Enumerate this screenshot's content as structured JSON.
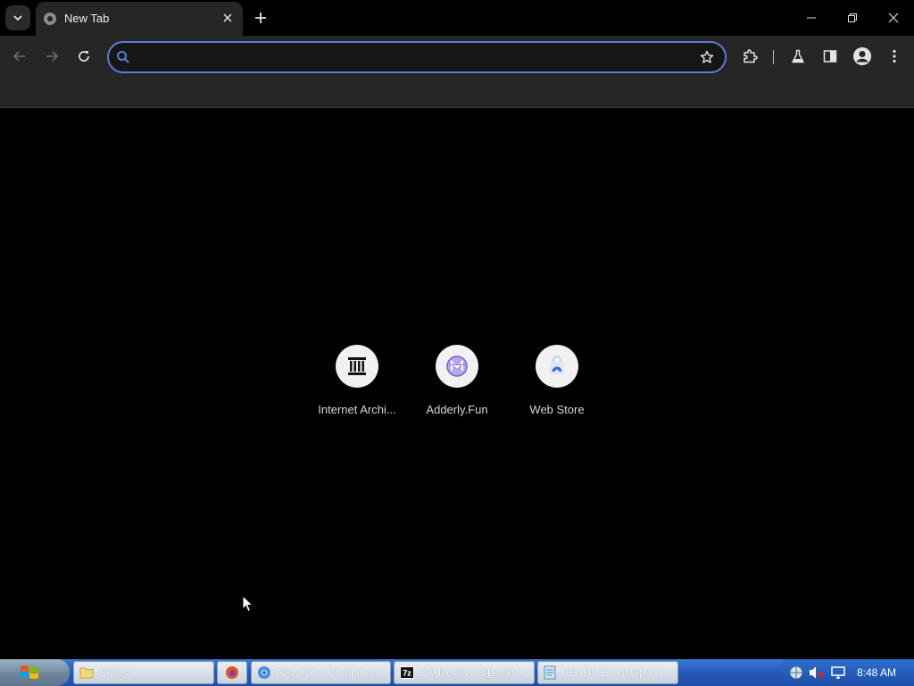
{
  "browser": {
    "tab": {
      "title": "New Tab"
    },
    "omnibox": {
      "value": "",
      "placeholder": ""
    }
  },
  "new_tab_page": {
    "shortcuts": [
      {
        "label": "Internet Archi...",
        "icon": "internet-archive-icon"
      },
      {
        "label": "Adderly.Fun",
        "icon": "adderly-icon"
      },
      {
        "label": "Web Store",
        "icon": "web-store-icon"
      }
    ]
  },
  "taskbar": {
    "buttons": [
      {
        "label": "Styles",
        "icon": "folder-icon"
      },
      {
        "label": "",
        "icon": "firefox-icon"
      },
      {
        "label": "New Tab - Chromium",
        "icon": "chromium-icon"
      },
      {
        "label": "C:\\Users\\vm3\\Deskt...",
        "icon": "7zip-icon"
      },
      {
        "label": "README - Notepad",
        "icon": "notepad-icon"
      }
    ],
    "clock": "8:48 AM"
  },
  "colors": {
    "page_background": "#000000",
    "toolbar": "#262626",
    "omnibox_focus": "#5c7ad9",
    "taskbar": "#2458b8"
  }
}
